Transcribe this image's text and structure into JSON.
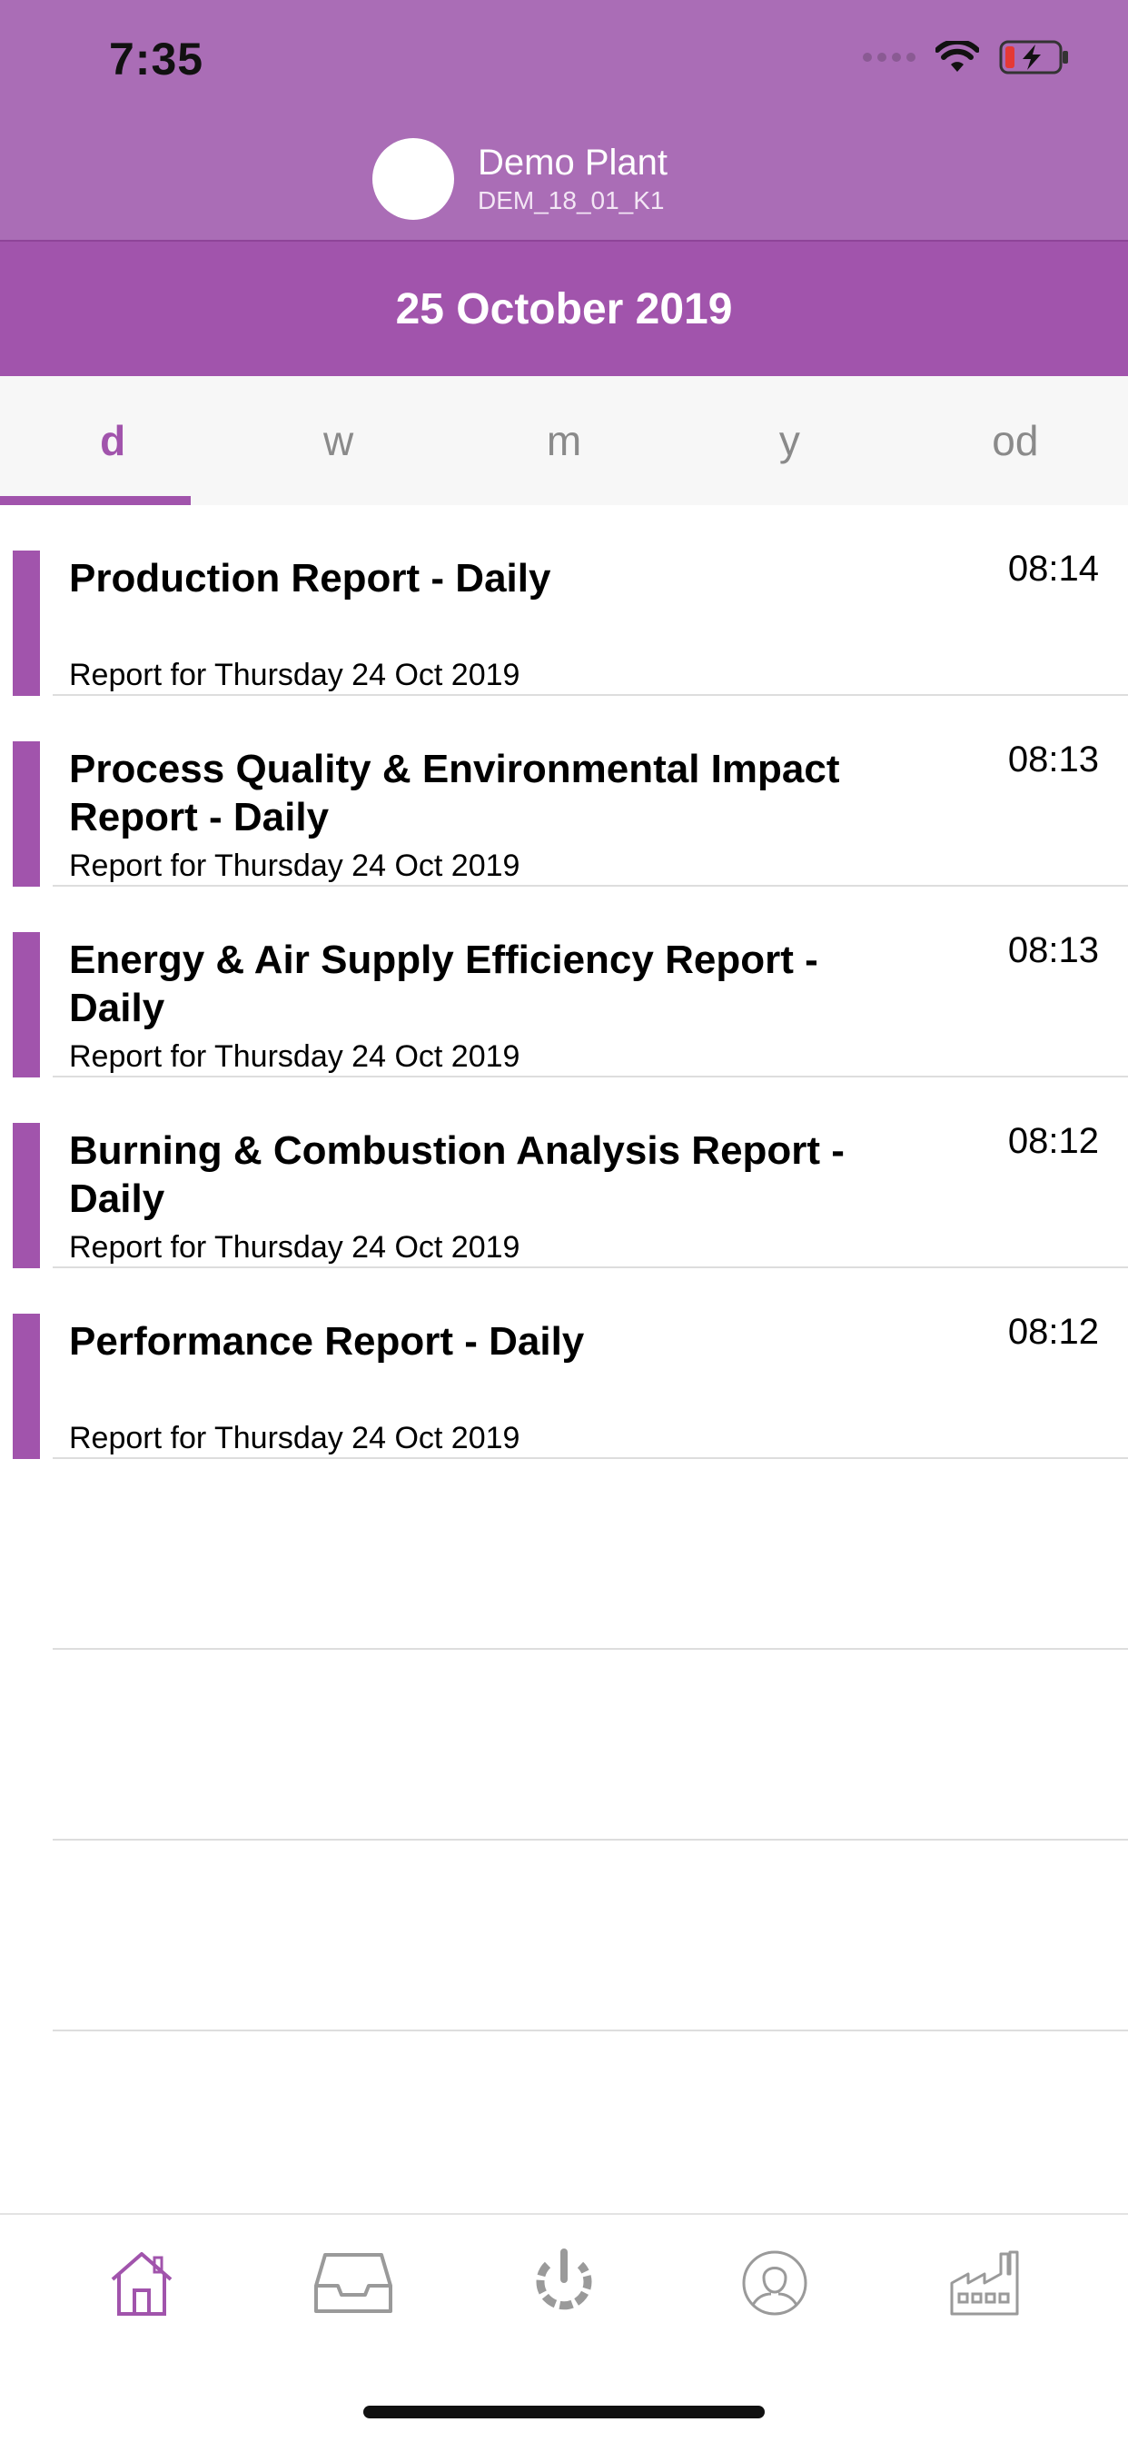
{
  "status_bar": {
    "time": "7:35"
  },
  "header": {
    "plant_name": "Demo Plant",
    "plant_code": "DEM_18_01_K1",
    "date": "25 October 2019"
  },
  "tabs": [
    {
      "label": "d",
      "active": true
    },
    {
      "label": "w",
      "active": false
    },
    {
      "label": "m",
      "active": false
    },
    {
      "label": "y",
      "active": false
    },
    {
      "label": "od",
      "active": false
    }
  ],
  "reports": [
    {
      "title": "Production Report - Daily",
      "time": "08:14",
      "subtitle": "Report for Thursday 24 Oct 2019"
    },
    {
      "title": "Process Quality & Environmental Impact Report - Daily",
      "time": "08:13",
      "subtitle": "Report for Thursday 24 Oct 2019"
    },
    {
      "title": "Energy & Air Supply Efficiency Report - Daily",
      "time": "08:13",
      "subtitle": "Report for Thursday 24 Oct 2019"
    },
    {
      "title": "Burning & Combustion Analysis Report - Daily",
      "time": "08:12",
      "subtitle": "Report for Thursday 24 Oct 2019"
    },
    {
      "title": "Performance Report - Daily",
      "time": "08:12",
      "subtitle": "Report for Thursday 24 Oct 2019"
    }
  ],
  "tabbar": {
    "icons": [
      "home-icon",
      "inbox-icon",
      "power-icon",
      "profile-icon",
      "factory-icon"
    ],
    "active_icon": "home-icon"
  },
  "colors": {
    "accent": "#a154ac",
    "header_bg": "#aa6db6",
    "inactive": "#9a9a9a"
  }
}
